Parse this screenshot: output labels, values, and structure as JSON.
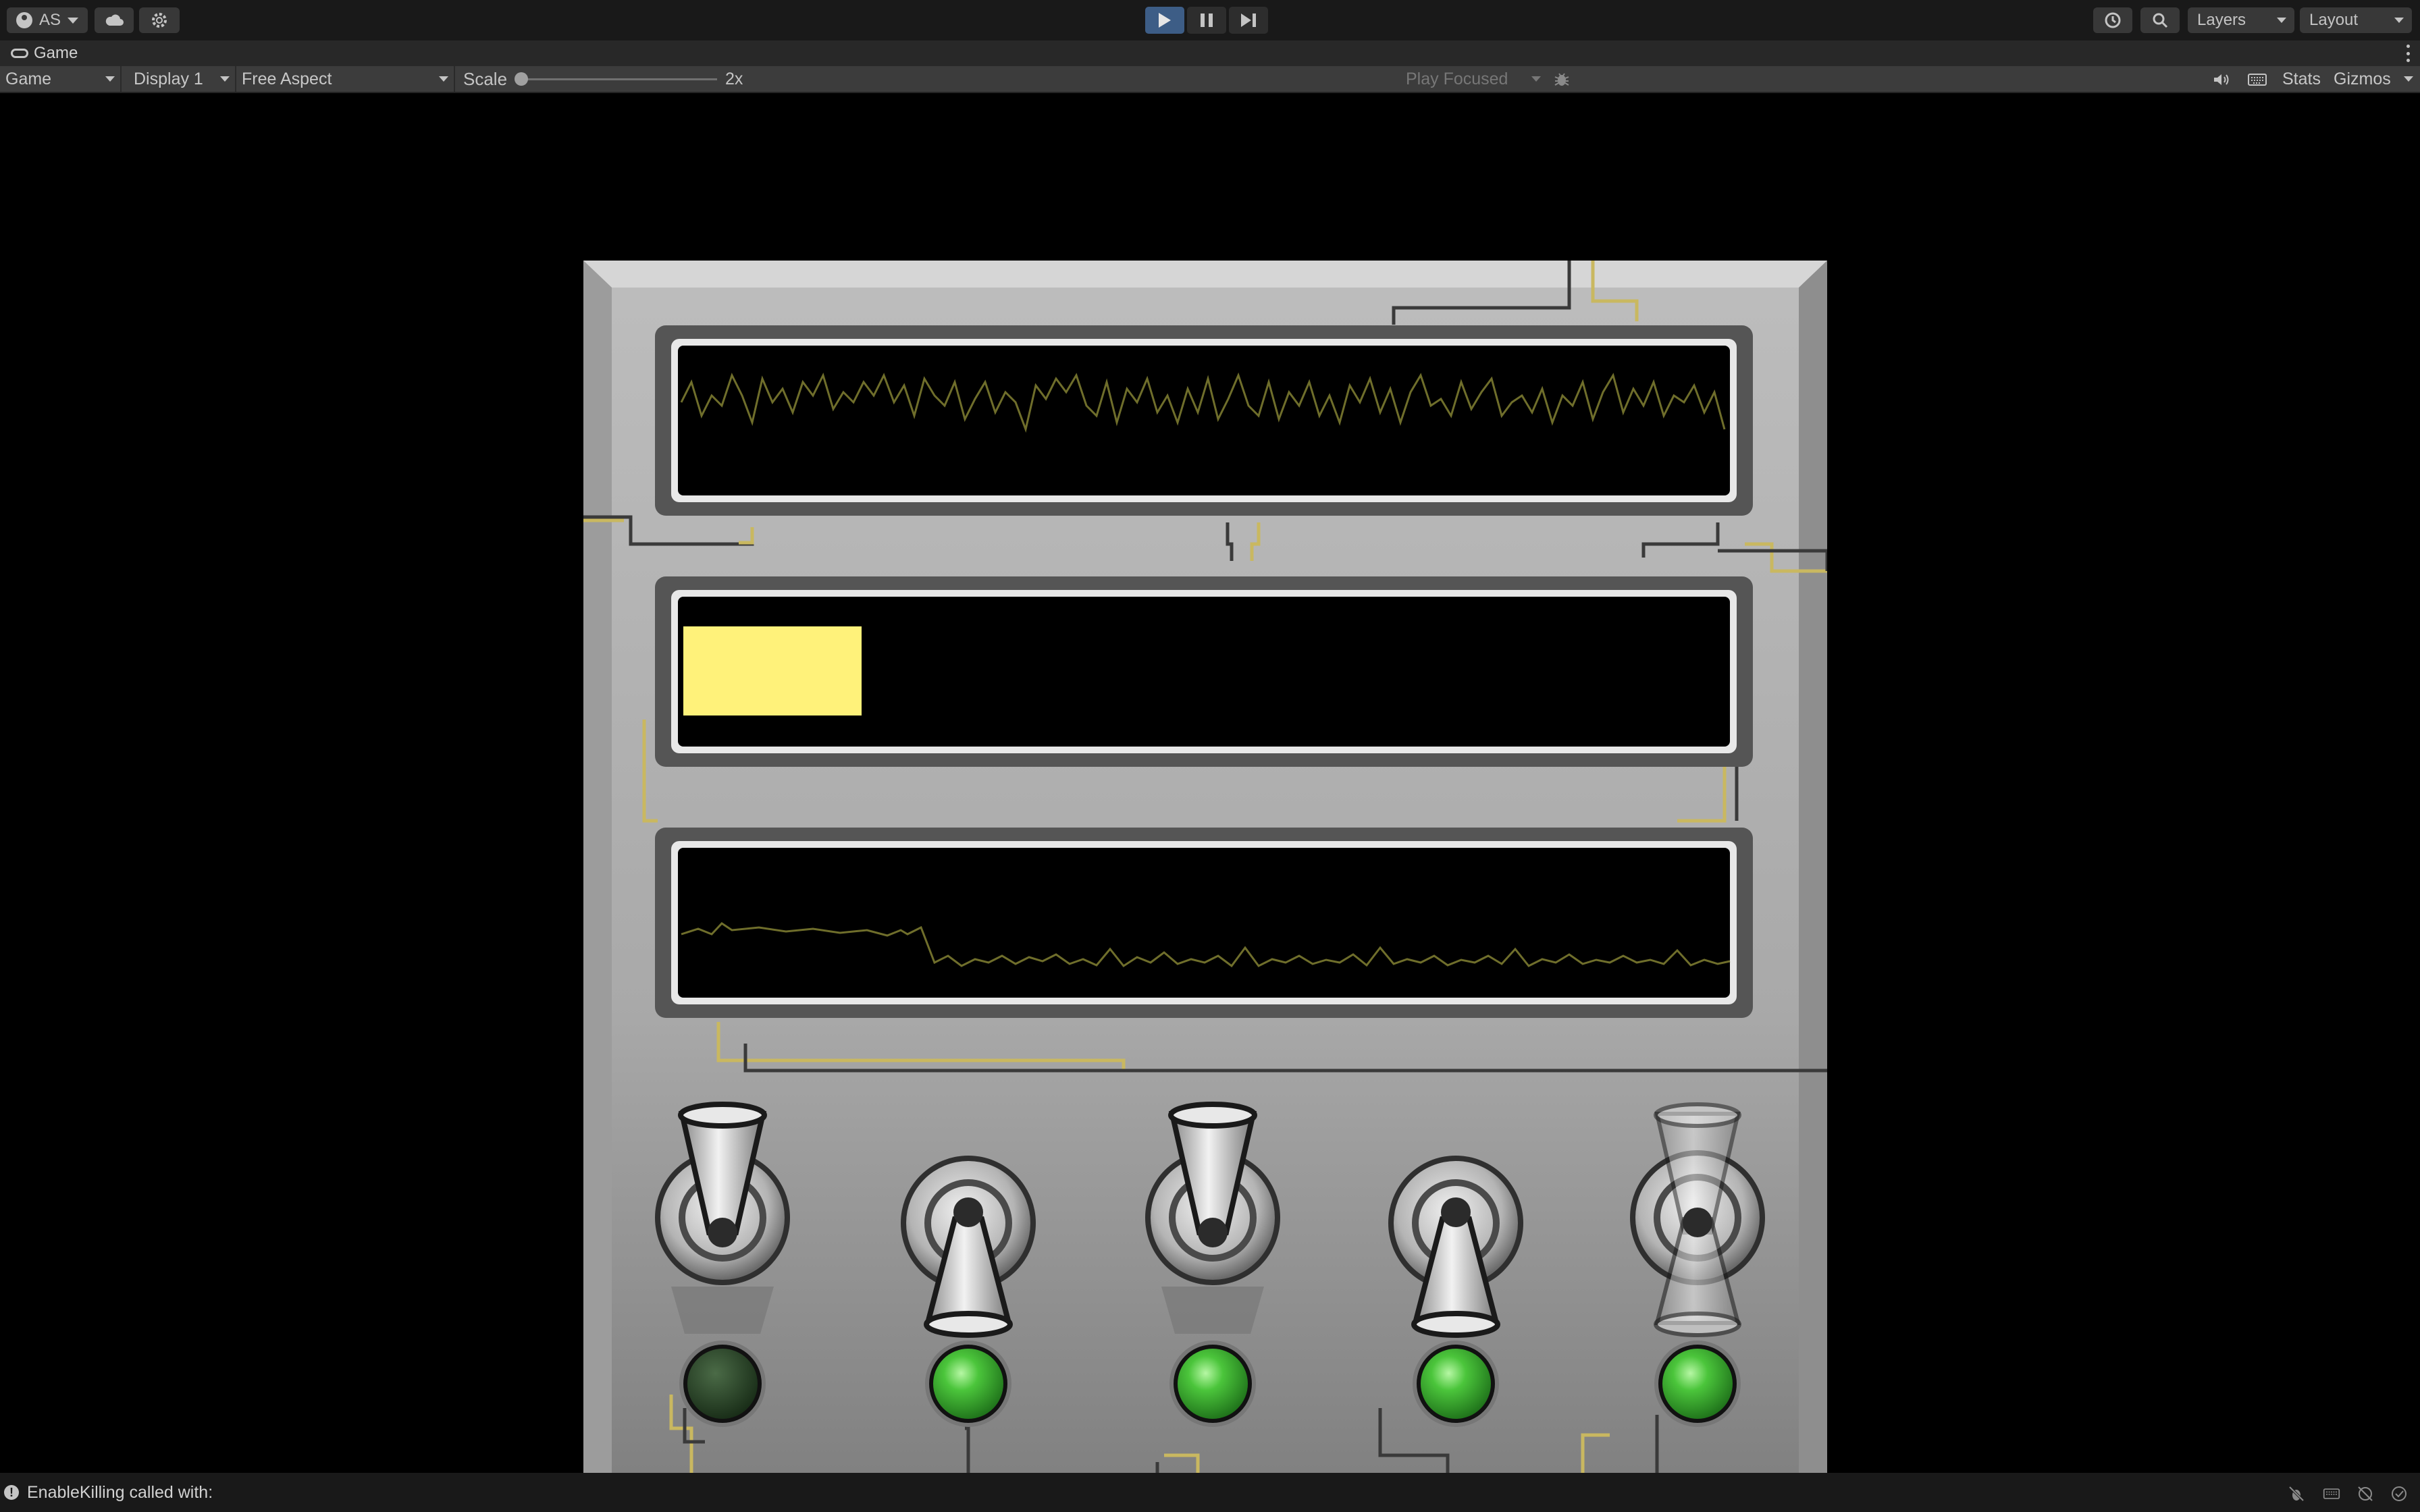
{
  "toolbar": {
    "account_label": "AS",
    "cloud_icon": "cloud-icon",
    "settings_icon": "gear-icon",
    "play_active": true,
    "layers_label": "Layers",
    "layout_label": "Layout"
  },
  "game_tab": {
    "label": "Game",
    "icon": "gamepad-icon"
  },
  "game_toolbar": {
    "view_mode": "Game",
    "display": "Display 1",
    "aspect": "Free Aspect",
    "scale_label": "Scale",
    "scale_value": "2x",
    "play_mode": "Play Focused",
    "stats_label": "Stats",
    "gizmos_label": "Gizmos"
  },
  "game": {
    "colors": {
      "panel": "#a8a8a8",
      "screen": "#000000",
      "waveform": "#6f6e2b",
      "highlight_block": "#fff27a",
      "light_off": "#1f3a1f",
      "light_on": "#3cb832",
      "wire": "#c9b860"
    },
    "switches": [
      {
        "position": "up",
        "light": "off"
      },
      {
        "position": "down",
        "light": "on"
      },
      {
        "position": "up",
        "light": "on"
      },
      {
        "position": "down",
        "light": "on"
      },
      {
        "position": "middle",
        "light": "on"
      }
    ]
  },
  "status": {
    "message": "EnableKilling called with:",
    "icons": [
      "bug-off-icon",
      "keyboard-icon",
      "network-off-icon",
      "check-circle-icon"
    ]
  }
}
